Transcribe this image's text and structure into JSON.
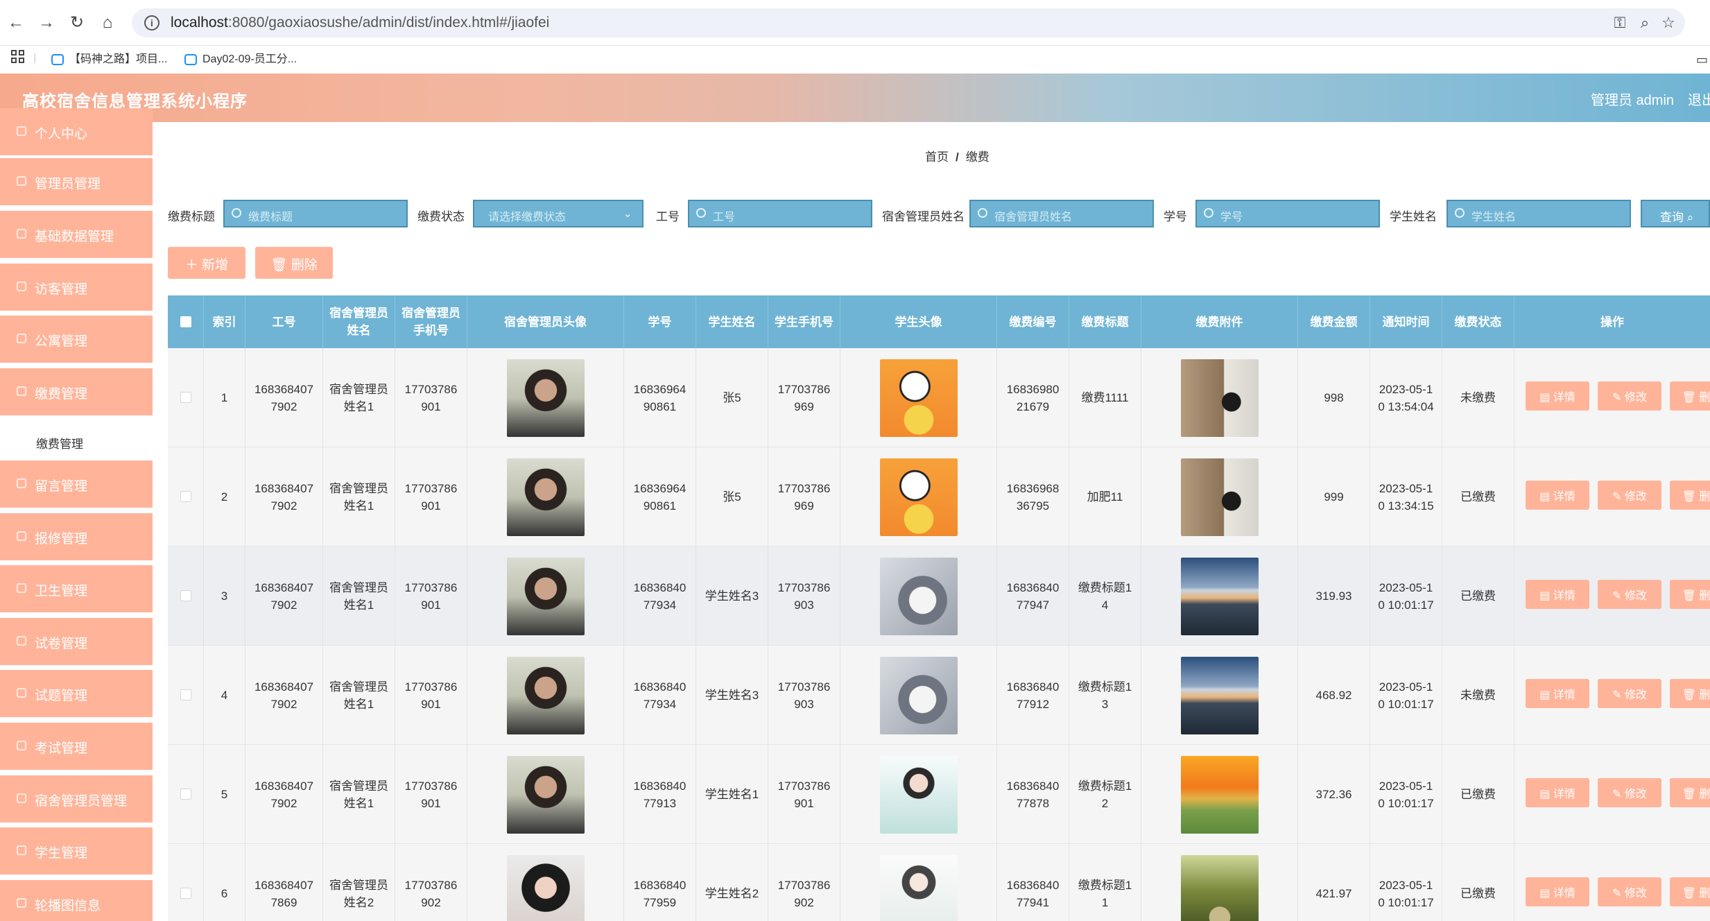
{
  "browser": {
    "url_host": "localhost",
    "url_rest": ":8080/gaoxiaosushe/admin/dist/index.html#/jiaofei",
    "bookmarks": [
      "【码神之路】项目...",
      "Day02-09-员工分..."
    ]
  },
  "header": {
    "title": "高校宿舍信息管理系统小程序",
    "admin": "管理员 admin",
    "logout": "退出"
  },
  "sidebar": {
    "items": [
      "个人中心",
      "管理员管理",
      "基础数据管理",
      "访客管理",
      "公寓管理",
      "缴费管理",
      "留言管理",
      "报修管理",
      "卫生管理",
      "试卷管理",
      "试题管理",
      "考试管理",
      "宿舍管理员管理",
      "学生管理",
      "轮播图信息"
    ],
    "submenu": "缴费管理"
  },
  "breadcrumb": {
    "home": "首页",
    "sep": "/",
    "current": "缴费"
  },
  "filters": {
    "title_label": "缴费标题",
    "title_ph": "缴费标题",
    "status_label": "缴费状态",
    "status_ph": "请选择缴费状态",
    "gonghao_label": "工号",
    "gonghao_ph": "工号",
    "manager_label": "宿舍管理员姓名",
    "manager_ph": "宿舍管理员姓名",
    "xuehao_label": "学号",
    "xuehao_ph": "学号",
    "student_label": "学生姓名",
    "student_ph": "学生姓名",
    "query": "查询"
  },
  "actions": {
    "add": "新增",
    "delete": "删除"
  },
  "table": {
    "headers": [
      "索引",
      "工号",
      "宿舍管理员姓名",
      "宿舍管理员手机号",
      "宿舍管理员头像",
      "学号",
      "学生姓名",
      "学生手机号",
      "学生头像",
      "缴费编号",
      "缴费标题",
      "缴费附件",
      "缴费金额",
      "通知时间",
      "缴费状态",
      "操作"
    ],
    "ops": {
      "detail": "详情",
      "edit": "修改",
      "delete": "删除"
    },
    "rows": [
      {
        "idx": "1",
        "gonghao": "168368407\n7902",
        "mname": "宿舍管理员\n姓名1",
        "mphone": "17703786\n901",
        "mavatar": "man",
        "xuehao": "16836964\n90861",
        "sname": "张5",
        "sphone": "17703786\n969",
        "savatar": "cartoon",
        "bianhao": "16836980\n21679",
        "jtitle": "缴费1111",
        "attach": "painting",
        "amount": "998",
        "time": "2023-05-1\n0 13:54:04",
        "status": "未缴费"
      },
      {
        "idx": "2",
        "gonghao": "168368407\n7902",
        "mname": "宿舍管理员\n姓名1",
        "mphone": "17703786\n901",
        "mavatar": "man",
        "xuehao": "16836964\n90861",
        "sname": "张5",
        "sphone": "17703786\n969",
        "savatar": "cartoon",
        "bianhao": "16836968\n36795",
        "jtitle": "加肥11",
        "attach": "painting",
        "amount": "999",
        "time": "2023-05-1\n0 13:34:15",
        "status": "已缴费"
      },
      {
        "idx": "3",
        "gonghao": "168368407\n7902",
        "mname": "宿舍管理员\n姓名1",
        "mphone": "17703786\n901",
        "mavatar": "man",
        "xuehao": "16836840\n77934",
        "sname": "学生姓名3",
        "sphone": "17703786\n903",
        "savatar": "husky",
        "bianhao": "16836840\n77947",
        "jtitle": "缴费标题1\n4",
        "attach": "city",
        "amount": "319.93",
        "time": "2023-05-1\n0 10:01:17",
        "status": "已缴费"
      },
      {
        "idx": "4",
        "gonghao": "168368407\n7902",
        "mname": "宿舍管理员\n姓名1",
        "mphone": "17703786\n901",
        "mavatar": "man",
        "xuehao": "16836840\n77934",
        "sname": "学生姓名3",
        "sphone": "17703786\n903",
        "savatar": "husky",
        "bianhao": "16836840\n77912",
        "jtitle": "缴费标题1\n3",
        "attach": "city",
        "amount": "468.92",
        "time": "2023-05-1\n0 10:01:17",
        "status": "未缴费"
      },
      {
        "idx": "5",
        "gonghao": "168368407\n7902",
        "mname": "宿舍管理员\n姓名1",
        "mphone": "17703786\n901",
        "mavatar": "man",
        "xuehao": "16836840\n77913",
        "sname": "学生姓名1",
        "sphone": "17703786\n901",
        "savatar": "girl",
        "bianhao": "16836840\n77878",
        "jtitle": "缴费标题1\n2",
        "attach": "sunset",
        "amount": "372.36",
        "time": "2023-05-1\n0 10:01:17",
        "status": "已缴费"
      },
      {
        "idx": "6",
        "gonghao": "168368407\n7869",
        "mname": "宿舍管理员\n姓名2",
        "mphone": "17703786\n902",
        "mavatar": "woman",
        "xuehao": "16836840\n77959",
        "sname": "学生姓名2",
        "sphone": "17703786\n902",
        "savatar": "ladydrawing",
        "bianhao": "16836840\n77941",
        "jtitle": "缴费标题1\n1",
        "attach": "forest",
        "amount": "421.97",
        "time": "2023-05-1\n0 10:01:17",
        "status": "已缴费"
      }
    ]
  },
  "colors": {
    "accent": "#ffb49a",
    "primary": "#6fb4d4"
  }
}
